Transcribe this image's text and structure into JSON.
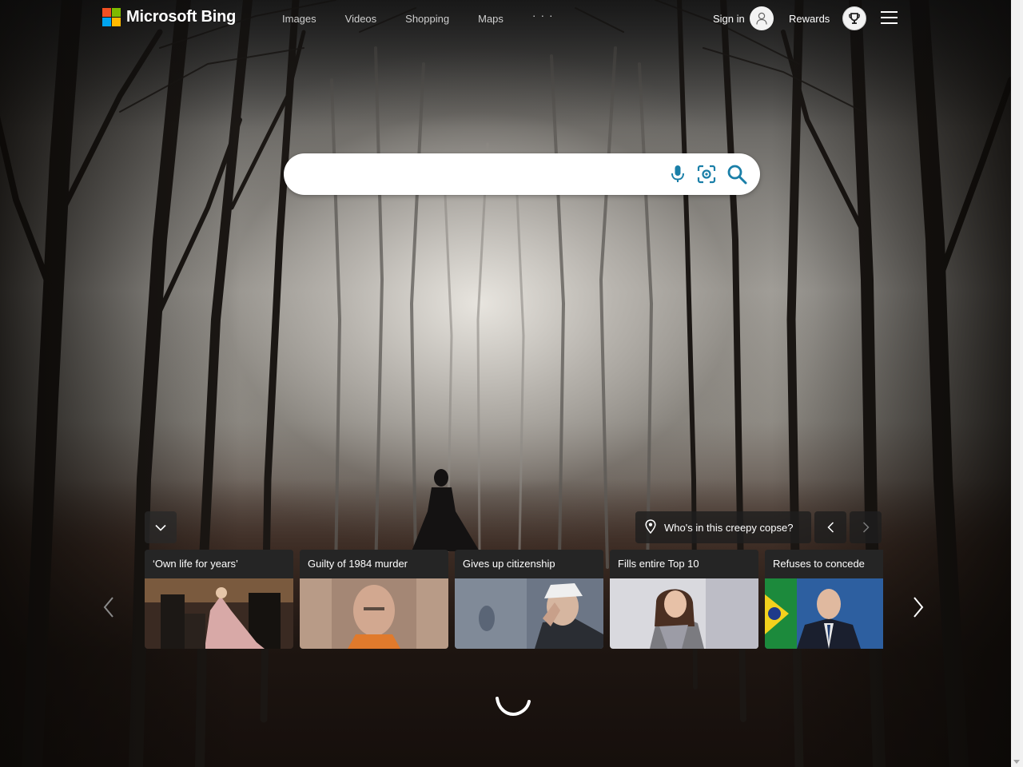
{
  "header": {
    "logo_text": "Microsoft Bing",
    "nav": [
      {
        "label": "Images"
      },
      {
        "label": "Videos"
      },
      {
        "label": "Shopping"
      },
      {
        "label": "Maps"
      }
    ],
    "more_label": "· · ·",
    "sign_in_label": "Sign in",
    "rewards_label": "Rewards"
  },
  "search": {
    "value": "",
    "placeholder": "",
    "icons": [
      "microphone-icon",
      "visual-search-icon",
      "search-icon"
    ]
  },
  "image_info": {
    "label": "Who's in this creepy copse?"
  },
  "news": [
    {
      "title": "‘Own life for years’"
    },
    {
      "title": "Guilty of 1984 murder"
    },
    {
      "title": "Gives up citizenship"
    },
    {
      "title": "Fills entire Top 10"
    },
    {
      "title": "Refuses to concede"
    }
  ],
  "colors": {
    "ms_red": "#f25022",
    "ms_green": "#7fba00",
    "ms_blue": "#00a4ef",
    "ms_yellow": "#ffb900",
    "search_icon_blue": "#1a7fa8"
  }
}
